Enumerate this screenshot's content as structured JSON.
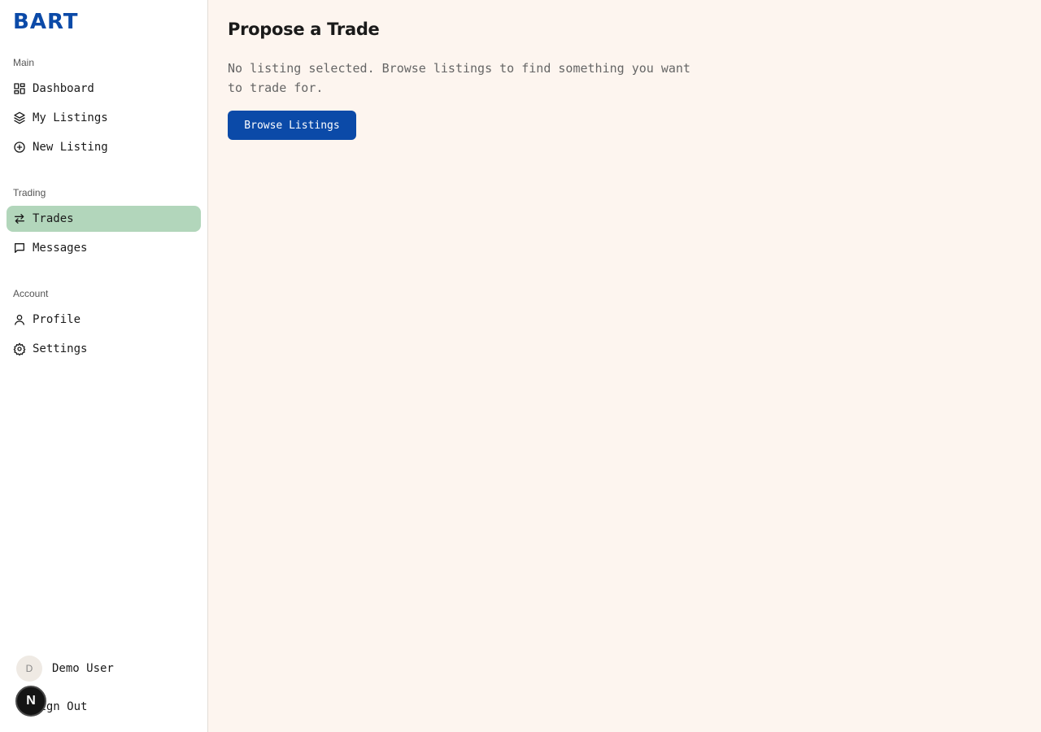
{
  "app": {
    "logo": "BART"
  },
  "sidebar": {
    "sections": [
      {
        "title": "Main",
        "items": [
          {
            "label": "Dashboard",
            "icon": "dashboard-icon"
          },
          {
            "label": "My Listings",
            "icon": "package-icon"
          },
          {
            "label": "New Listing",
            "icon": "plus-circle-icon"
          }
        ]
      },
      {
        "title": "Trading",
        "items": [
          {
            "label": "Trades",
            "icon": "swap-icon",
            "active": true
          },
          {
            "label": "Messages",
            "icon": "message-icon"
          }
        ]
      },
      {
        "title": "Account",
        "items": [
          {
            "label": "Profile",
            "icon": "user-icon"
          },
          {
            "label": "Settings",
            "icon": "gear-icon"
          }
        ]
      }
    ],
    "user": {
      "initial": "D",
      "name": "Demo User"
    },
    "signout_label": "Sign Out",
    "dev_badge": "N"
  },
  "main": {
    "title": "Propose a Trade",
    "description": "No listing selected. Browse listings to find something you want to trade for.",
    "browse_button": "Browse Listings"
  },
  "colors": {
    "accent": "#0b4aa8",
    "active_nav": "#b2d6bb",
    "background": "#fdf5ef"
  }
}
